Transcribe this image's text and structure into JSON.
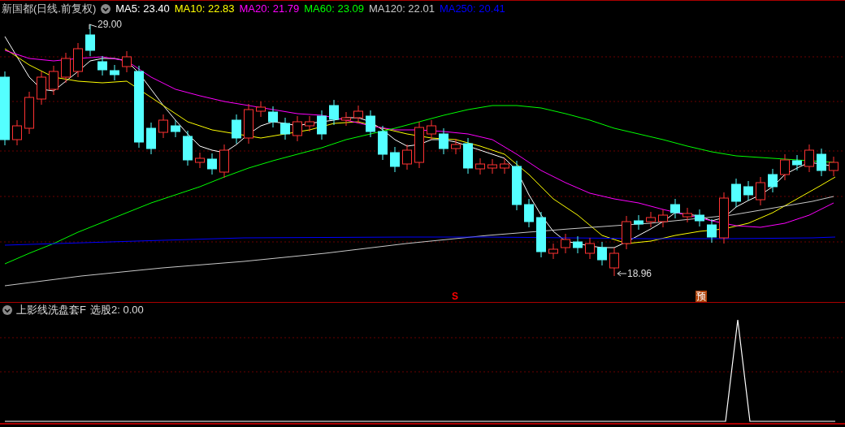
{
  "title": "新国都(日线.前复权)",
  "ma_legend": [
    {
      "label": "MA5: 23.40",
      "color": "#ffffff"
    },
    {
      "label": "MA10: 22.83",
      "color": "#ffff00"
    },
    {
      "label": "MA20: 21.79",
      "color": "#ff00ff"
    },
    {
      "label": "MA60: 23.09",
      "color": "#00ff00"
    },
    {
      "label": "MA120: 22.01",
      "color": "#c8c8c8"
    },
    {
      "label": "MA250: 20.41",
      "color": "#0000ff"
    }
  ],
  "price_labels": [
    {
      "kind": "high",
      "text": "29.00"
    },
    {
      "kind": "low",
      "text": "18.96"
    }
  ],
  "signals": [
    {
      "kind": "sell",
      "text": "S"
    },
    {
      "kind": "forecast",
      "text": "预"
    }
  ],
  "indicator": {
    "name": "上影线洗盘套F",
    "value": "选股2: 0.00"
  }
}
